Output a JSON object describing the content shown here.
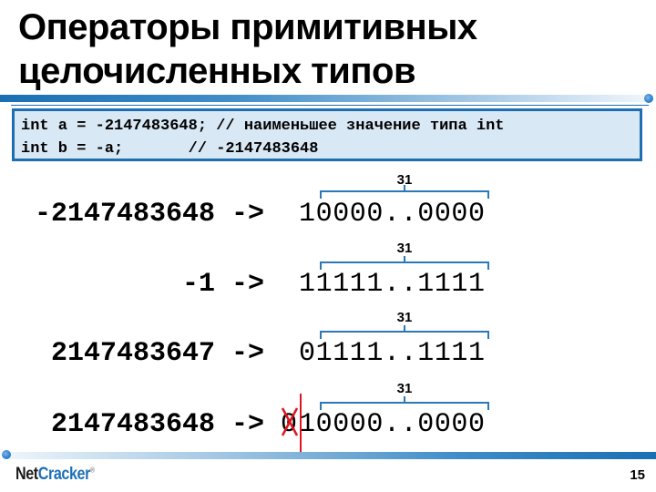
{
  "slide": {
    "title_line1": "Операторы примитивных",
    "title_line2": "целочисленных типов",
    "code": {
      "line1": "int a = -2147483648; // наименьшее значение типа int",
      "line2": "int b = -a;       // -2147483648"
    },
    "rows": [
      {
        "decimal": "-2147483648 ->",
        "binary": "10000..0000",
        "brace_label": "31"
      },
      {
        "decimal": "-1 ->",
        "binary": "11111..1111",
        "brace_label": "31"
      },
      {
        "decimal": "2147483647 ->",
        "binary": "01111..1111",
        "brace_label": "31"
      },
      {
        "decimal": "2147483648 ->",
        "binary": "10000..0000",
        "brace_label": "31",
        "overflow_bit": "0"
      }
    ],
    "accent_color": "#1e6fb0",
    "strike_color": "#e0141c"
  },
  "footer": {
    "logo_part1": "Net",
    "logo_part2": "Cracker",
    "logo_reg": "®",
    "page_number": "15"
  }
}
